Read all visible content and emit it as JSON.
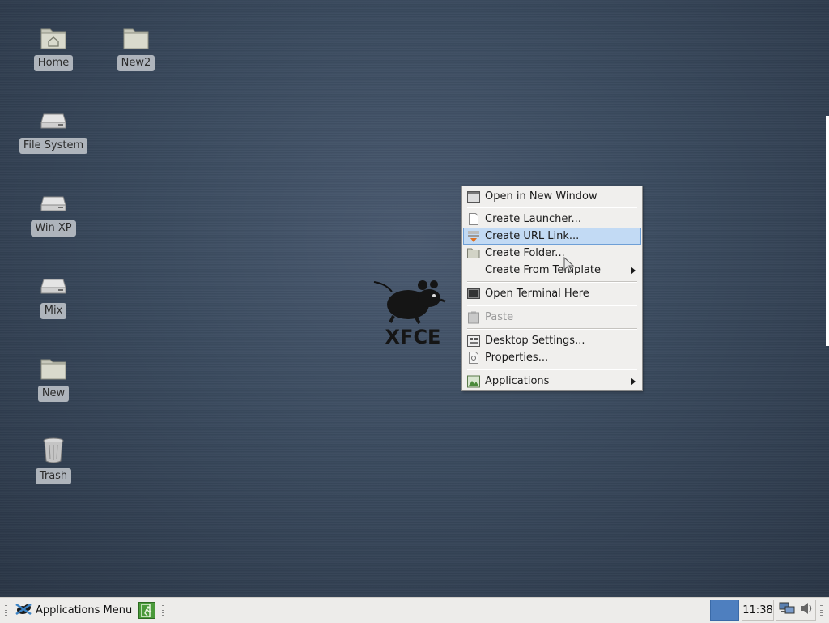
{
  "desktop": {
    "icons": [
      {
        "label": "Home",
        "icon": "home-folder-icon"
      },
      {
        "label": "New2",
        "icon": "folder-icon"
      },
      {
        "label": "File System",
        "icon": "drive-icon"
      },
      {
        "label": "Win XP",
        "icon": "drive-icon"
      },
      {
        "label": "Mix",
        "icon": "drive-icon"
      },
      {
        "label": "New",
        "icon": "folder-icon"
      },
      {
        "label": "Trash",
        "icon": "trash-icon"
      }
    ],
    "logo_text": "XFCE"
  },
  "context_menu": {
    "items": [
      {
        "label": "Open in New Window",
        "icon": "window-icon"
      },
      {
        "label": "Create Launcher...",
        "icon": "document-icon"
      },
      {
        "label": "Create URL Link...",
        "icon": "url-link-icon",
        "highlighted": true
      },
      {
        "label": "Create Folder...",
        "icon": "folder-icon"
      },
      {
        "label": "Create From Template",
        "submenu": true
      },
      {
        "label": "Open Terminal Here",
        "icon": "terminal-icon"
      },
      {
        "label": "Paste",
        "icon": "paste-icon",
        "disabled": true
      },
      {
        "label": "Desktop Settings...",
        "icon": "desktop-settings-icon"
      },
      {
        "label": "Properties...",
        "icon": "properties-icon"
      },
      {
        "label": "Applications",
        "icon": "applications-icon",
        "submenu": true
      }
    ]
  },
  "panel": {
    "apps_menu_label": "Applications Menu",
    "clock": "11:38"
  },
  "colors": {
    "highlight": "#c2daf4",
    "workspace": "#4e7fbf",
    "panel": "#edecea"
  }
}
